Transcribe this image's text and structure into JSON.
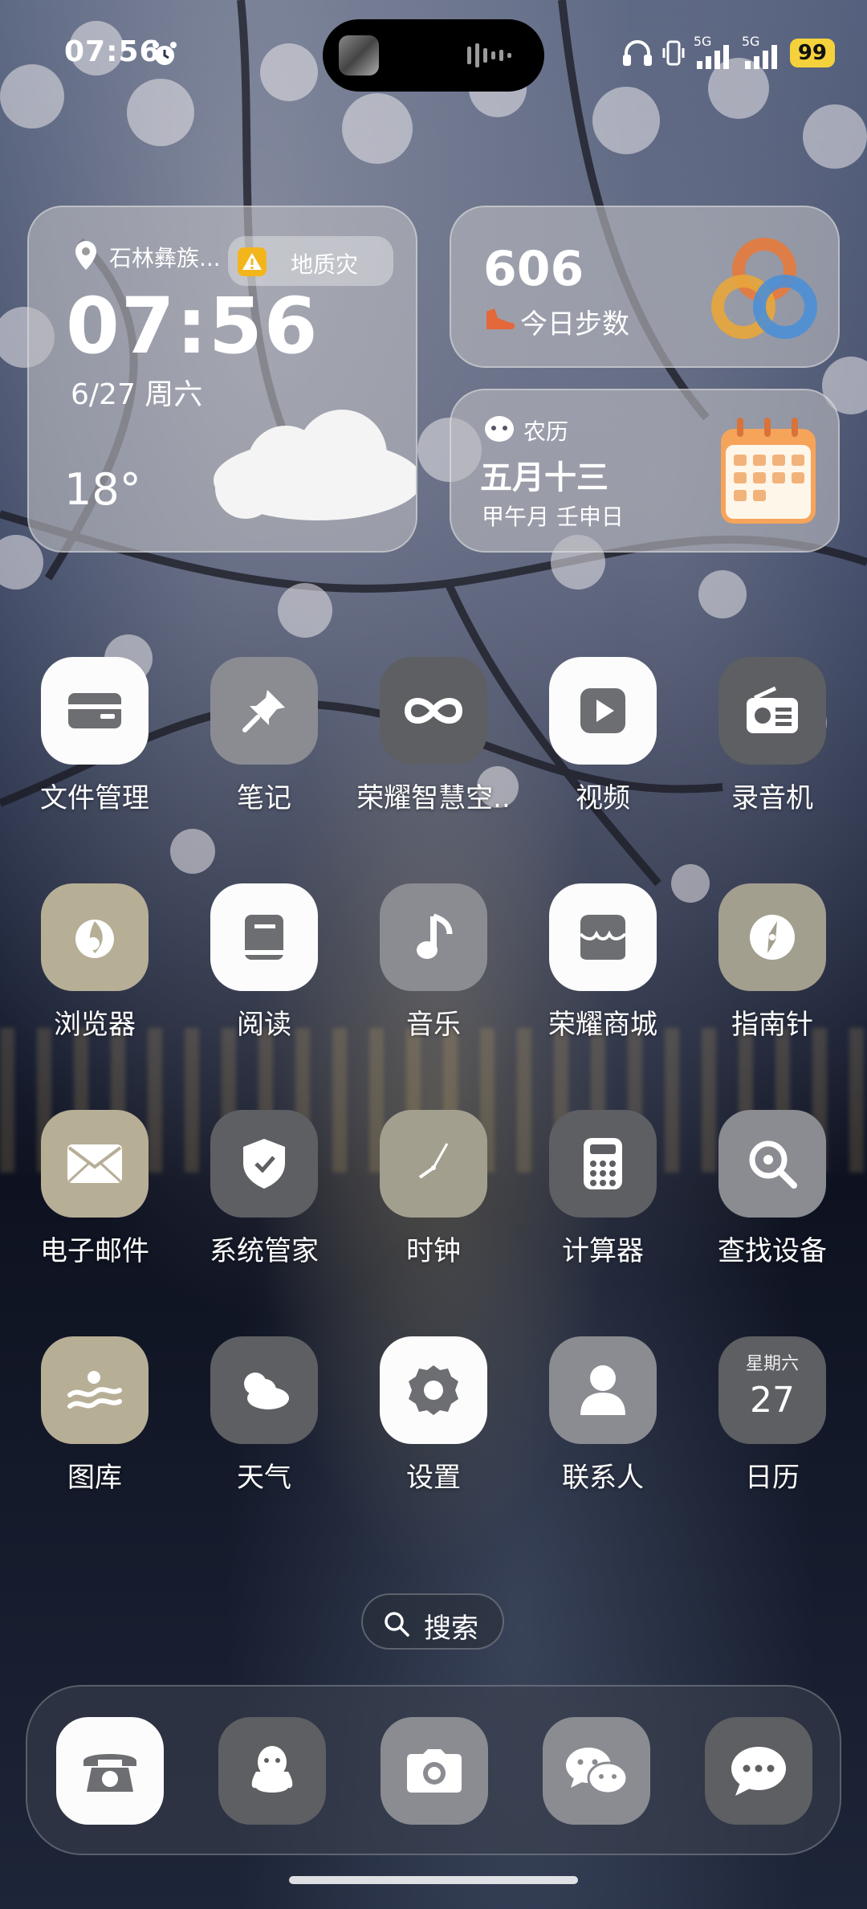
{
  "status_bar": {
    "time": "07:56",
    "network_1": "5G",
    "network_2": "5G",
    "battery": "99"
  },
  "widgets": {
    "clock": {
      "location": "石林彝族...",
      "alert": "地质灾",
      "time": "07:56",
      "date": "6/27 周六",
      "temperature": "18°"
    },
    "steps": {
      "count": "606",
      "label": "今日步数"
    },
    "lunar": {
      "label": "农历",
      "date": "五月十三",
      "sub": "甲午月 壬申日"
    }
  },
  "apps": [
    {
      "label": "文件管理",
      "icon": "folder-card-icon"
    },
    {
      "label": "笔记",
      "icon": "pin-icon"
    },
    {
      "label": "荣耀智慧空..",
      "icon": "infinity-icon"
    },
    {
      "label": "视频",
      "icon": "play-icon"
    },
    {
      "label": "录音机",
      "icon": "radio-icon"
    },
    {
      "label": "浏览器",
      "icon": "browser-icon"
    },
    {
      "label": "阅读",
      "icon": "book-icon"
    },
    {
      "label": "音乐",
      "icon": "music-note-icon"
    },
    {
      "label": "荣耀商城",
      "icon": "store-icon"
    },
    {
      "label": "指南针",
      "icon": "compass-icon"
    },
    {
      "label": "电子邮件",
      "icon": "mail-icon"
    },
    {
      "label": "系统管家",
      "icon": "shield-check-icon"
    },
    {
      "label": "时钟",
      "icon": "clock-icon"
    },
    {
      "label": "计算器",
      "icon": "calculator-icon"
    },
    {
      "label": "查找设备",
      "icon": "find-device-icon"
    },
    {
      "label": "图库",
      "icon": "gallery-icon"
    },
    {
      "label": "天气",
      "icon": "weather-cloud-icon"
    },
    {
      "label": "设置",
      "icon": "gear-icon"
    },
    {
      "label": "联系人",
      "icon": "contact-icon"
    },
    {
      "label": "日历",
      "icon": "calendar-icon",
      "weekday": "星期六",
      "day": "27"
    }
  ],
  "search": {
    "label": "搜索"
  },
  "dock": [
    {
      "name": "phone",
      "icon": "phone-icon"
    },
    {
      "name": "qq",
      "icon": "penguin-icon"
    },
    {
      "name": "camera",
      "icon": "camera-icon"
    },
    {
      "name": "wechat",
      "icon": "wechat-icon"
    },
    {
      "name": "messages",
      "icon": "message-bubble-icon"
    }
  ]
}
